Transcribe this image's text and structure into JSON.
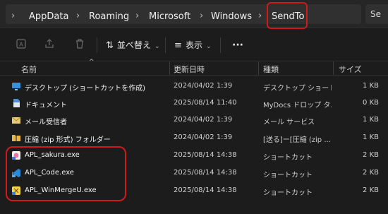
{
  "breadcrumb": [
    "AppData",
    "Roaming",
    "Microsoft",
    "Windows",
    "SendTo"
  ],
  "search": {
    "placeholder": "Se"
  },
  "toolbar": {
    "sort_label": "並べ替え",
    "view_label": "表示",
    "more_label": "···",
    "icons": [
      "ai-icon",
      "share-icon",
      "delete-icon"
    ]
  },
  "columns": {
    "name": "名前",
    "date": "更新日時",
    "type": "種類",
    "size": "サイズ"
  },
  "files": [
    {
      "name": "デスクトップ (ショートカットを作成)",
      "date": "2024/04/02 1:39",
      "type": "デスクトップ ショートカ...",
      "size": "1 KB",
      "icon": "desktop-icon"
    },
    {
      "name": "ドキュメント",
      "date": "2025/08/14 11:40",
      "type": "MyDocs ドロップ タ...",
      "size": "0 KB",
      "icon": "document-icon"
    },
    {
      "name": "メール受信者",
      "date": "2024/04/02 1:39",
      "type": "メール サービス",
      "size": "1 KB",
      "icon": "mail-icon"
    },
    {
      "name": "圧縮 (zip 形式) フォルダー",
      "date": "2024/04/02 1:39",
      "type": "[送る]ー[圧縮 (zip ...",
      "size": "1 KB",
      "icon": "zip-folder-icon"
    },
    {
      "name": "APL_sakura.exe",
      "date": "2025/08/14 14:38",
      "type": "ショートカット",
      "size": "2 KB",
      "icon": "sakura-app-icon"
    },
    {
      "name": "APL_Code.exe",
      "date": "2025/08/14 14:38",
      "type": "ショートカット",
      "size": "2 KB",
      "icon": "vscode-app-icon"
    },
    {
      "name": "APL_WinMergeU.exe",
      "date": "2025/08/14 14:38",
      "type": "ショートカット",
      "size": "2 KB",
      "icon": "winmerge-app-icon"
    }
  ],
  "colors": {
    "highlight": "#d01b1b",
    "background": "#1c1c1c",
    "accent": "#4aa3ff"
  }
}
